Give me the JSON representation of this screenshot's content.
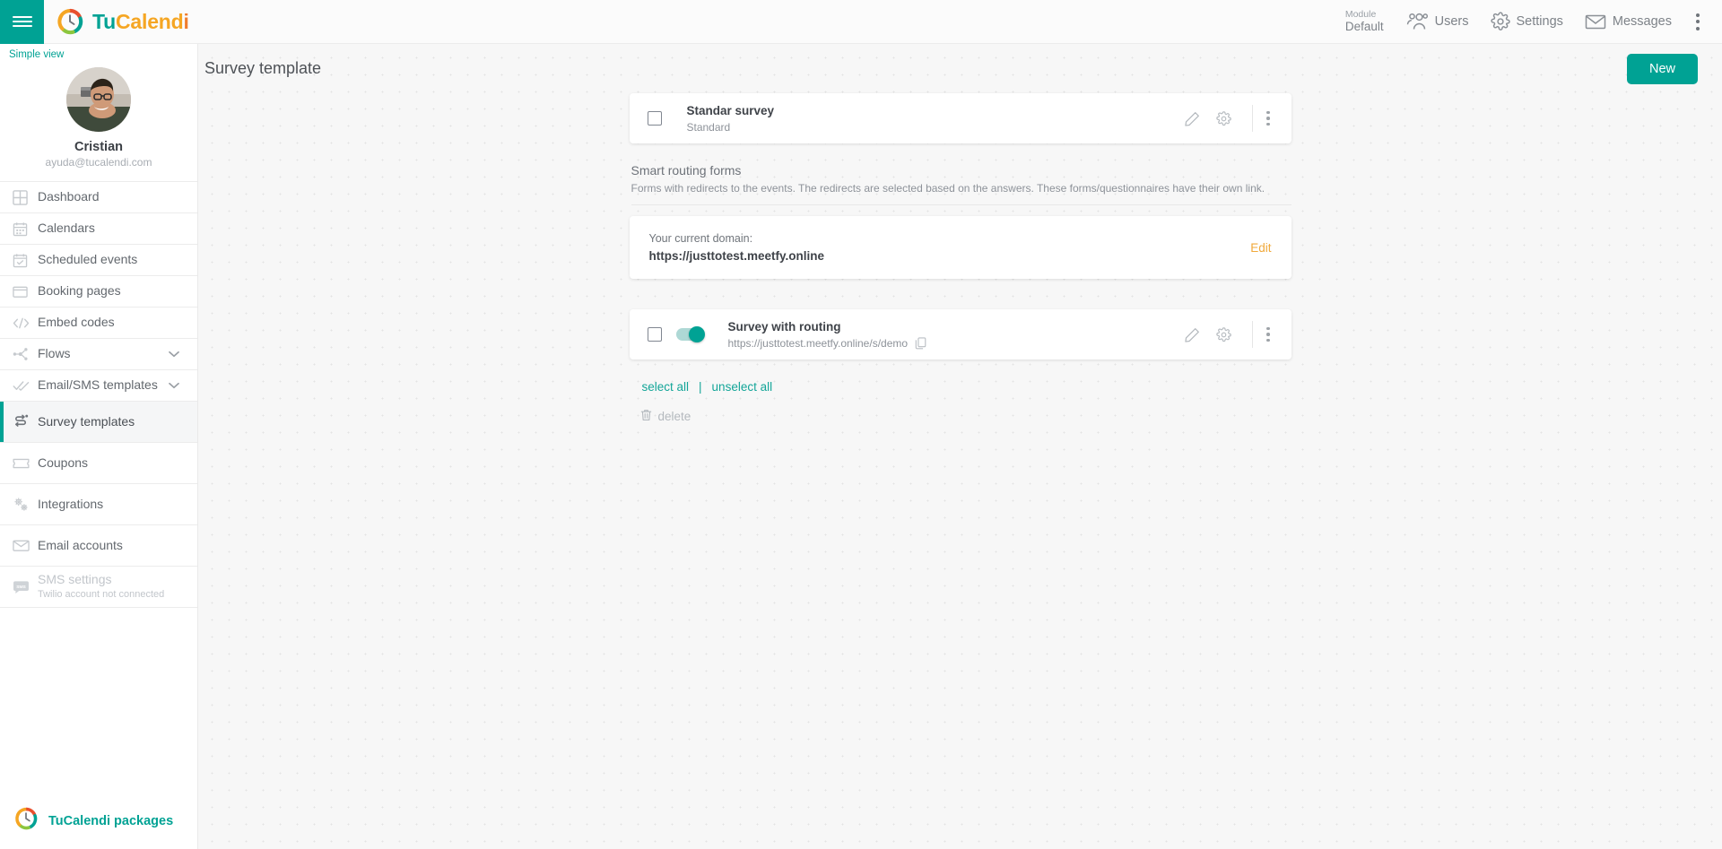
{
  "topbar": {
    "hamburger_icon": "menu-icon",
    "brand": {
      "part1": "Tu",
      "part2": "Calend",
      "part3": "i"
    },
    "module": {
      "label": "Module",
      "value": "Default"
    },
    "users": "Users",
    "settings": "Settings",
    "messages": "Messages",
    "overflow_icon": "kebab-menu-icon"
  },
  "sidebar": {
    "simple_view": "Simple view",
    "profile": {
      "name": "Cristian",
      "email": "ayuda@tucalendi.com"
    },
    "items": [
      {
        "label": "Dashboard",
        "icon": "dashboard-icon"
      },
      {
        "label": "Calendars",
        "icon": "calendar-icon"
      },
      {
        "label": "Scheduled events",
        "icon": "calendar-check-icon"
      },
      {
        "label": "Booking pages",
        "icon": "window-icon"
      },
      {
        "label": "Embed codes",
        "icon": "code-icon"
      },
      {
        "label": "Flows",
        "icon": "flow-icon",
        "chevron": true
      },
      {
        "label": "Email/SMS templates",
        "icon": "double-check-icon",
        "chevron": true
      },
      {
        "label": "Survey templates",
        "icon": "survey-icon",
        "active": true
      },
      {
        "label": "Coupons",
        "icon": "ticket-icon"
      },
      {
        "label": "Integrations",
        "icon": "gears-icon"
      },
      {
        "label": "Email accounts",
        "icon": "envelope-icon"
      },
      {
        "label": "SMS settings",
        "sublabel": "Twilio account not connected",
        "icon": "sms-bubble-icon",
        "disabled": true
      }
    ],
    "packages_link": "TuCalendi packages"
  },
  "main": {
    "page_title": "Survey template",
    "new_button": "New",
    "standard_survey": {
      "title": "Standar survey",
      "subtitle": "Standard",
      "edit_icon": "pencil-icon",
      "settings_icon": "gear-icon",
      "more_icon": "kebab-menu-icon"
    },
    "routing_section": {
      "title": "Smart routing forms",
      "description": "Forms with redirects to the events. The redirects are selected based on the answers. These forms/questionnaires have their own link."
    },
    "domain_card": {
      "label": "Your current domain:",
      "value": "https://justtotest.meetfy.online",
      "edit_label": "Edit"
    },
    "routing_survey": {
      "title": "Survey with routing",
      "url": "https://justtotest.meetfy.online/s/demo",
      "copy_icon": "copy-icon",
      "toggle_state": "on",
      "edit_icon": "pencil-icon",
      "settings_icon": "gear-icon",
      "more_icon": "kebab-menu-icon"
    },
    "select_all": "select all",
    "separator": "|",
    "unselect_all": "unselect all",
    "delete": "delete",
    "delete_icon": "trash-icon"
  },
  "colors": {
    "accent_teal": "#00a294",
    "link_teal": "#13a598",
    "edit_orange": "#f0a93b",
    "brand_orange": "#f5a623"
  }
}
